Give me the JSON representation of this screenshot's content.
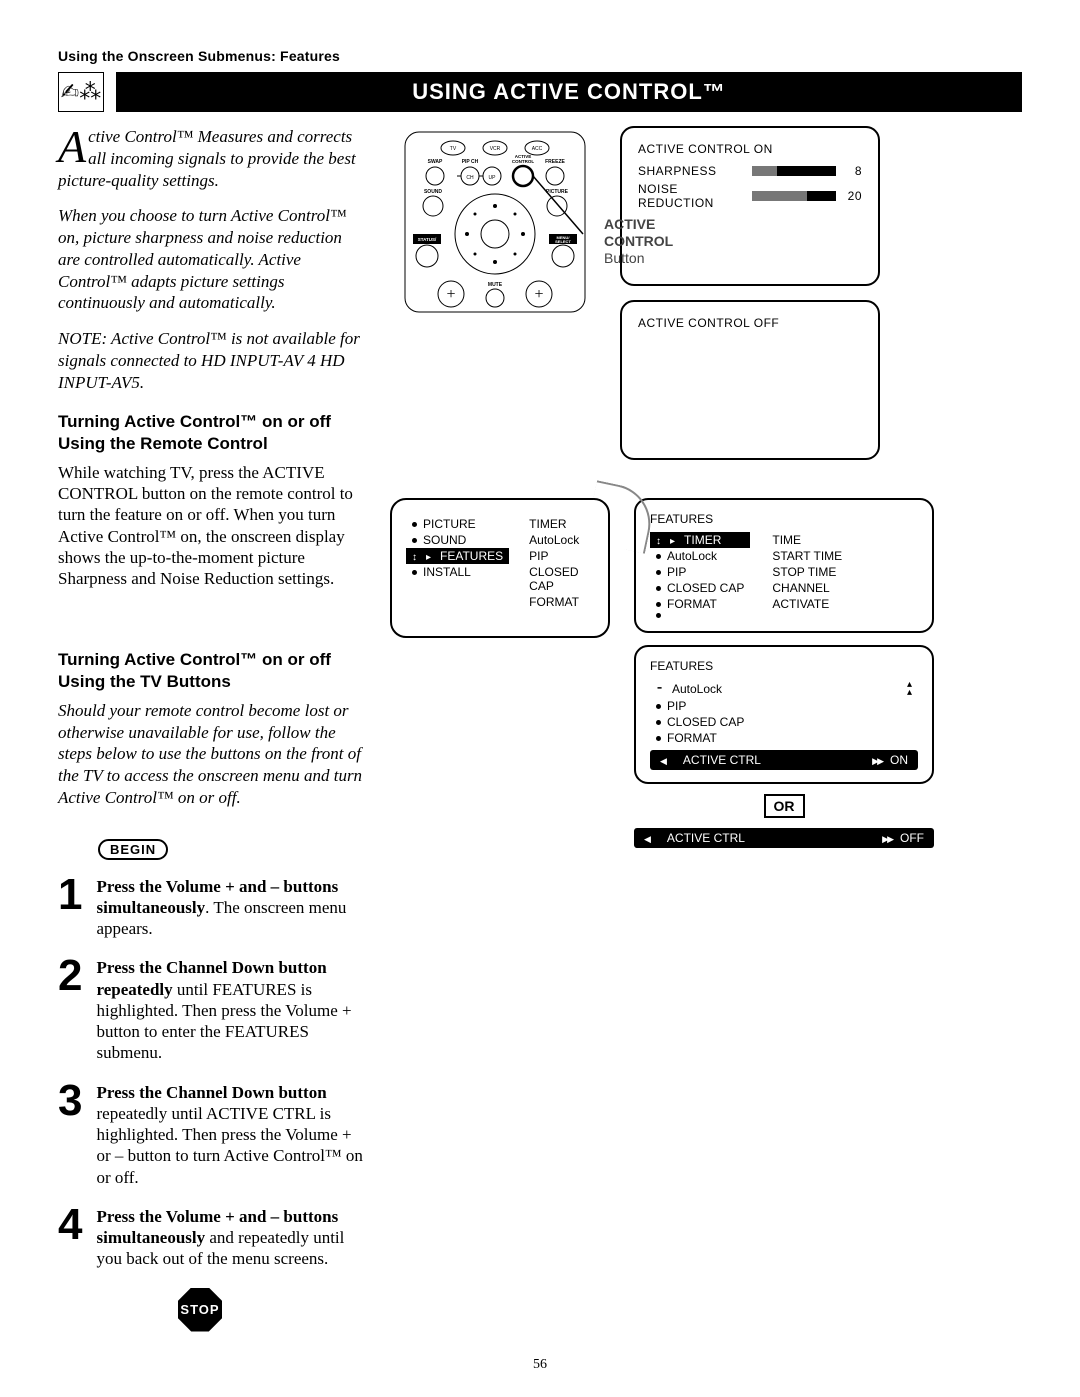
{
  "breadcrumb": "Using the Onscreen Submenus: Features",
  "title": "USING ACTIVE CONTROL™",
  "intro": {
    "dropcap": "A",
    "rest": "ctive Control™ Measures and corrects all incoming signals to provide the best picture-quality settings."
  },
  "para2": "When you choose to turn Active Control™ on, picture sharpness and noise reduction are controlled automatically. Active Control™ adapts picture settings continuously and automatically.",
  "note": "NOTE: Active Control™ is not available for signals connected to HD INPUT-AV 4 HD INPUT-AV5.",
  "subhead1": "Turning Active Control™ on or off Using the Remote Control",
  "body1": "While watching TV, press the ACTIVE CONTROL button on the remote control to turn the feature on or off. When you turn Active Control™ on, the onscreen display shows the up-to-the-moment picture Sharpness and Noise Reduction settings.",
  "subhead2": "Turning Active Control™ on or off Using the TV Buttons",
  "body2_italic": "Should your remote control become lost or otherwise unavailable for use, follow the steps below to use the buttons on the front of the TV to access the onscreen menu and turn Active Control™ on or off.",
  "begin": "BEGIN",
  "stop": "STOP",
  "steps": [
    {
      "n": "1",
      "bold": "Press the Volume + and – buttons simultaneously",
      "rest": ". The onscreen menu appears."
    },
    {
      "n": "2",
      "bold": "Press the Channel Down button repeatedly",
      "rest": " until FEATURES is highlighted. Then press the Volume + button to enter the FEATURES submenu."
    },
    {
      "n": "3",
      "bold": "Press the Channel Down button",
      "rest": " repeatedly until ACTIVE CTRL is highlighted. Then press the Volume + or – button to turn Active Control™ on or off."
    },
    {
      "n": "4",
      "bold": "Press the Volume + and – buttons simultaneously",
      "rest": " and repeatedly until you back out of the menu screens."
    }
  ],
  "remote": {
    "label_line1": "ACTIVE",
    "label_line2": "CONTROL",
    "label_line3": "Button",
    "buttons_row1": [
      "TV",
      "VCR",
      "ACC"
    ],
    "buttons_row2": [
      "SWAP",
      "PIP CH",
      "ACTIVE CONTROL",
      "FREEZE"
    ],
    "buttons_row3": [
      "CH",
      "UP"
    ],
    "labels": {
      "sound": "SOUND",
      "picture": "PICTURE",
      "status": "STATUS/ EXIT",
      "menu": "MENU/ SELECT",
      "mute": "MUTE"
    }
  },
  "osd_on": {
    "title": "ACTIVE CONTROL  ON",
    "rows": [
      {
        "label": "SHARPNESS",
        "value": "8",
        "fill": 30
      },
      {
        "label": "NOISE REDUCTION",
        "value": "20",
        "fill": 65
      }
    ]
  },
  "osd_off": {
    "title": "ACTIVE CONTROL  OFF"
  },
  "main_menu": {
    "left": [
      {
        "label": "PICTURE",
        "selected": false
      },
      {
        "label": "SOUND",
        "selected": false
      },
      {
        "label": "FEATURES",
        "selected": true
      },
      {
        "label": "INSTALL",
        "selected": false
      }
    ],
    "right": [
      "TIMER",
      "AutoLock",
      "PIP",
      "CLOSED CAP",
      "FORMAT"
    ]
  },
  "features1": {
    "title": "FEATURES",
    "left": [
      {
        "label": "TIMER",
        "selected": true
      },
      {
        "label": "AutoLock"
      },
      {
        "label": "PIP"
      },
      {
        "label": "CLOSED CAP"
      },
      {
        "label": "FORMAT"
      },
      {
        "label": ""
      }
    ],
    "right": [
      "TIME",
      "START TIME",
      "STOP TIME",
      "CHANNEL",
      "ACTIVATE"
    ]
  },
  "features2": {
    "title": "FEATURES",
    "items": [
      {
        "label": "AutoLock",
        "lock": true
      },
      {
        "label": "PIP"
      },
      {
        "label": "CLOSED CAP"
      },
      {
        "label": "FORMAT"
      }
    ],
    "active_ctrl": {
      "label": "ACTIVE CTRL",
      "value": "ON"
    }
  },
  "or": "OR",
  "active_ctrl_off": {
    "label": "ACTIVE CTRL",
    "value": "OFF"
  },
  "page_num": "56"
}
